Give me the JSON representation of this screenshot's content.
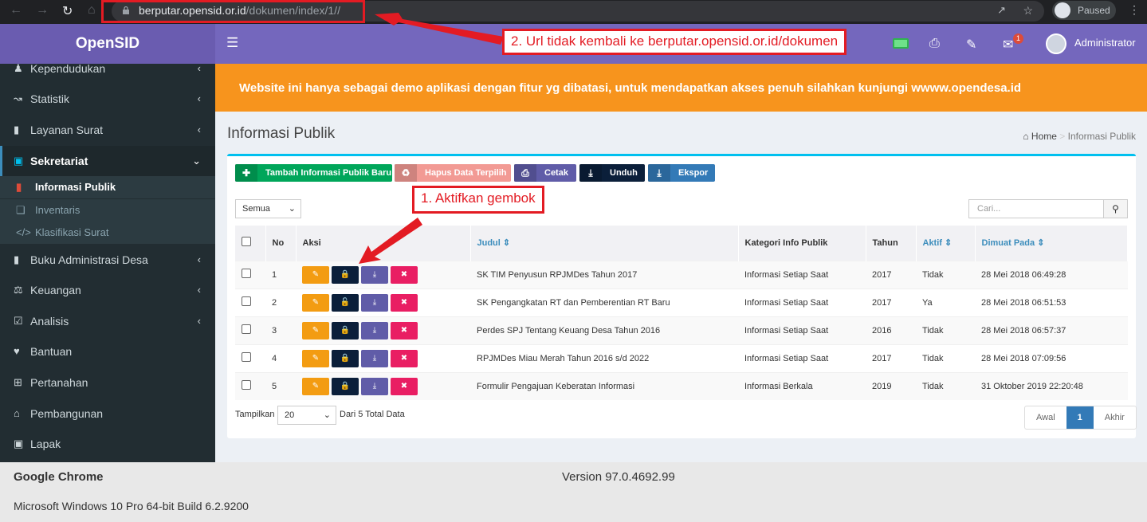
{
  "browser": {
    "url_host": "berputar.opensid.or.id",
    "url_path": "/dokumen/index/1//",
    "profile_status": "Paused"
  },
  "app": {
    "logo": "OpenSID",
    "user": "Administrator",
    "notification_count": "1",
    "banner": "Website ini hanya sebagai demo aplikasi dengan fitur yg dibatasi, untuk mendapatkan akses penuh silahkan kunjungi wwww.opendesa.id"
  },
  "sidebar": {
    "items": [
      {
        "label": "Kependudukan",
        "icon": "users-icon"
      },
      {
        "label": "Statistik",
        "icon": "chart-icon"
      },
      {
        "label": "Layanan Surat",
        "icon": "book-icon"
      },
      {
        "label": "Sekretariat",
        "icon": "archive-icon"
      },
      {
        "label": "Buku Administrasi Desa",
        "icon": "book-icon"
      },
      {
        "label": "Keuangan",
        "icon": "balance-icon"
      },
      {
        "label": "Analisis",
        "icon": "check-square-icon"
      },
      {
        "label": "Bantuan",
        "icon": "heart-icon"
      },
      {
        "label": "Pertanahan",
        "icon": "road-icon"
      },
      {
        "label": "Pembangunan",
        "icon": "bank-icon"
      },
      {
        "label": "Lapak",
        "icon": "cart-icon"
      }
    ],
    "subitems": [
      {
        "label": "Informasi Publik",
        "icon": "file-icon"
      },
      {
        "label": "Inventaris",
        "icon": "cubes-icon"
      },
      {
        "label": "Klasifikasi Surat",
        "icon": "code-icon"
      }
    ]
  },
  "page": {
    "title": "Informasi Publik",
    "breadcrumb_home": "Home",
    "breadcrumb_current": "Informasi Publik"
  },
  "toolbar": {
    "add": "Tambah Informasi Publik Baru",
    "delete": "Hapus Data Terpilih",
    "print": "Cetak",
    "download": "Unduh",
    "export": "Ekspor"
  },
  "filter": {
    "selected": "Semua",
    "search_placeholder": "Cari..."
  },
  "table": {
    "headers": {
      "no": "No",
      "aksi": "Aksi",
      "judul": "Judul",
      "kategori": "Kategori Info Publik",
      "tahun": "Tahun",
      "aktif": "Aktif",
      "dimuat": "Dimuat Pada"
    },
    "rows": [
      {
        "no": "1",
        "judul": "SK TIM Penyusun RPJMDes Tahun 2017",
        "kategori": "Informasi Setiap Saat",
        "tahun": "2017",
        "aktif": "Tidak",
        "dimuat": "28 Mei 2018 06:49:28"
      },
      {
        "no": "2",
        "judul": "SK Pengangkatan RT dan Pemberentian RT Baru",
        "kategori": "Informasi Setiap Saat",
        "tahun": "2017",
        "aktif": "Ya",
        "dimuat": "28 Mei 2018 06:51:53"
      },
      {
        "no": "3",
        "judul": "Perdes SPJ Tentang Keuang Desa Tahun 2016",
        "kategori": "Informasi Setiap Saat",
        "tahun": "2016",
        "aktif": "Tidak",
        "dimuat": "28 Mei 2018 06:57:37"
      },
      {
        "no": "4",
        "judul": "RPJMDes Miau Merah Tahun 2016 s/d 2022",
        "kategori": "Informasi Setiap Saat",
        "tahun": "2017",
        "aktif": "Tidak",
        "dimuat": "28 Mei 2018 07:09:56"
      },
      {
        "no": "5",
        "judul": "Formulir Pengajuan Keberatan Informasi",
        "kategori": "Informasi Berkala",
        "tahun": "2019",
        "aktif": "Tidak",
        "dimuat": "31 Oktober 2019 22:20:48"
      }
    ]
  },
  "footer_bar": {
    "show_label": "Tampilkan",
    "per_page": "20",
    "total": "Dari 5 Total Data",
    "first": "Awal",
    "current": "1",
    "last": "Akhir"
  },
  "sysinfo": {
    "app": "Google Chrome",
    "version": "Version 97.0.4692.99",
    "os": "Microsoft Windows 10 Pro 64-bit Build 6.2.9200"
  },
  "annotations": {
    "one": "1. Aktifkan gembok",
    "two": "2. Url tidak kembali ke berputar.opensid.or.id/dokumen"
  },
  "colors": {
    "accent": "#7467bd",
    "banner": "#f7941d",
    "annotation": "#e31b23"
  }
}
